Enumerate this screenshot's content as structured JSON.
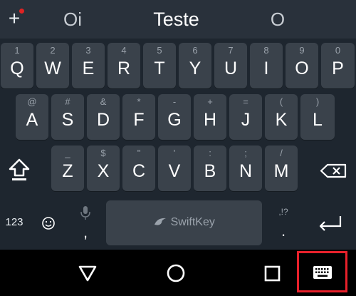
{
  "suggestions": {
    "left": "Oi",
    "center": "Teste",
    "right": "O"
  },
  "rows": {
    "row1": [
      {
        "hint": "1",
        "label": "Q"
      },
      {
        "hint": "2",
        "label": "W"
      },
      {
        "hint": "3",
        "label": "E"
      },
      {
        "hint": "4",
        "label": "R"
      },
      {
        "hint": "5",
        "label": "T"
      },
      {
        "hint": "6",
        "label": "Y"
      },
      {
        "hint": "7",
        "label": "U"
      },
      {
        "hint": "8",
        "label": "I"
      },
      {
        "hint": "9",
        "label": "O"
      },
      {
        "hint": "0",
        "label": "P"
      }
    ],
    "row2": [
      {
        "hint": "@",
        "label": "A"
      },
      {
        "hint": "#",
        "label": "S"
      },
      {
        "hint": "&",
        "label": "D"
      },
      {
        "hint": "*",
        "label": "F"
      },
      {
        "hint": "-",
        "label": "G"
      },
      {
        "hint": "+",
        "label": "H"
      },
      {
        "hint": "=",
        "label": "J"
      },
      {
        "hint": "(",
        "label": "K"
      },
      {
        "hint": ")",
        "label": "L"
      }
    ],
    "row3": [
      {
        "hint": "_",
        "label": "Z"
      },
      {
        "hint": "$",
        "label": "X"
      },
      {
        "hint": "\"",
        "label": "C"
      },
      {
        "hint": "'",
        "label": "V"
      },
      {
        "hint": ":",
        "label": "B"
      },
      {
        "hint": ";",
        "label": "N"
      },
      {
        "hint": "/",
        "label": "M"
      }
    ]
  },
  "bottom_row": {
    "numbers_label": "123",
    "comma_label": ",",
    "space_label": "SwiftKey",
    "period_hint": ",!?",
    "period_label": "."
  },
  "colors": {
    "key_bg": "#3a424b",
    "keyboard_bg": "#1e262f",
    "highlight": "#e8212b"
  },
  "icons": {
    "plus": "plus-icon",
    "emoji": "smiley-icon",
    "mic": "microphone-icon",
    "shift": "shift-arrow-icon",
    "backspace": "backspace-icon",
    "enter": "enter-arrow-icon",
    "back": "back-triangle-icon",
    "home": "home-circle-icon",
    "recents": "recents-square-icon",
    "keyboard": "keyboard-icon"
  }
}
